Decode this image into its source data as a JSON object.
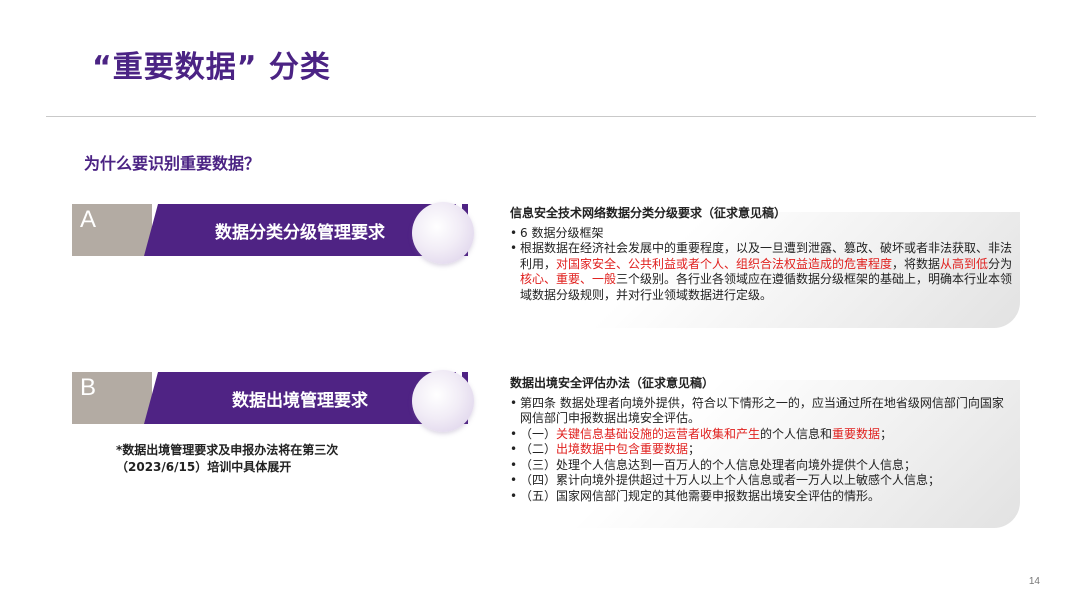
{
  "slide": {
    "title": "“重要数据” 分类",
    "question": "为什么要识别重要数据？",
    "page_number": "14"
  },
  "section_a": {
    "letter": "A",
    "label": "数据分类分级管理要求",
    "heading": "信息安全技术网络数据分类分级要求（征求意见稿）",
    "item1": "6 数据分级框架",
    "item2_parts": {
      "p1": "根据数据在经济社会发展中的重要程度，以及一旦遭到泄露、篡改、破坏或者非法获取、非法利用，",
      "p2_red": "对国家安全、公共利益或者个人、组织合法权益造成的危害程度",
      "p3": "，将数据",
      "p4_red": "从高到低",
      "p5": "分为",
      "p6_red": "核心、重要、一般",
      "p7": "三个级别。各行业各领域应在遵循数据分级框架的基础上，明确本行业本领域数据分级规则，并对行业领域数据进行定级。"
    }
  },
  "section_b": {
    "letter": "B",
    "label": "数据出境管理要求",
    "heading": "数据出境安全评估办法（征求意见稿）",
    "item1": "第四条 数据处理者向境外提供，符合以下情形之一的，应当通过所在地省级网信部门向国家网信部门申报数据出境安全评估。",
    "item2": {
      "p1": "（一）",
      "p2_red": "关键信息基础设施的运营者收集和产生",
      "p3": "的个人信息和",
      "p4_red": "重要数据",
      "p5": "；"
    },
    "item3": {
      "p1": "（二）",
      "p2_red": "出境数据中包含重要数据",
      "p3": "；"
    },
    "item4": "（三）处理个人信息达到一百万人的个人信息处理者向境外提供个人信息；",
    "item5": "（四）累计向境外提供超过十万人以上个人信息或者一万人以上敏感个人信息；",
    "item6": "（五）国家网信部门规定的其他需要申报数据出境安全评估的情形。"
  },
  "note": {
    "line1": "*数据出境管理要求及申报办法将在第三次",
    "line2": "（2023/6/15）培训中具体展开"
  },
  "colors": {
    "brand_purple": "#4f2384",
    "tab_gray": "#b3aba3",
    "highlight_red": "#e0201e"
  },
  "icons": {
    "decorative_circle": "circle-icon"
  }
}
